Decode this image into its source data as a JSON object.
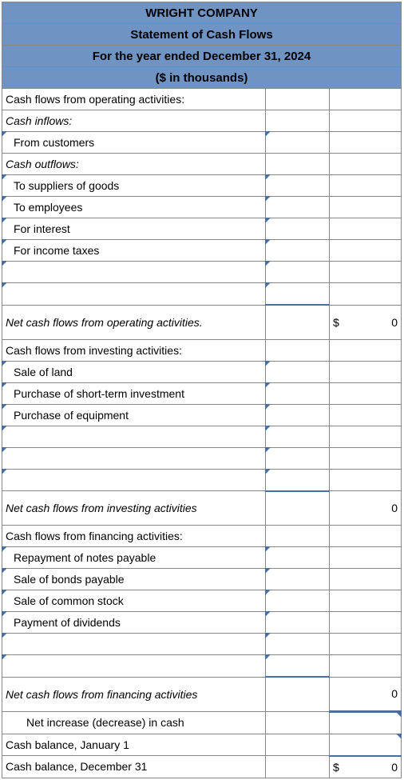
{
  "header": {
    "company": "WRIGHT COMPANY",
    "title": "Statement of Cash Flows",
    "period": "For the year ended December 31, 2024",
    "units": "($ in thousands)"
  },
  "rows": {
    "op_header": "Cash flows from operating activities:",
    "inflows": "Cash inflows:",
    "from_customers": "From customers",
    "outflows": "Cash outflows:",
    "to_suppliers": "To suppliers of goods",
    "to_employees": "To employees",
    "for_interest": "For interest",
    "for_taxes": "For income taxes",
    "net_op": "Net cash flows from operating activities.",
    "inv_header": "Cash flows from investing activities:",
    "sale_land": "Sale of land",
    "purchase_st": "Purchase of short-term investment",
    "purchase_eq": "Purchase of equipment",
    "net_inv": "Net cash flows from investing activities",
    "fin_header": "Cash flows from financing activities:",
    "repay_notes": "Repayment of notes payable",
    "sale_bonds": "Sale of bonds payable",
    "sale_stock": "Sale of common stock",
    "pay_div": "Payment of dividends",
    "net_fin": "Net cash flows from financing activities",
    "net_change": "Net increase (decrease) in cash",
    "beg_bal": "Cash balance, January 1",
    "end_bal": "Cash balance, December 31"
  },
  "values": {
    "net_op_sym": "$",
    "net_op_val": "0",
    "net_inv_val": "0",
    "net_fin_val": "0",
    "end_sym": "$",
    "end_val": "0"
  }
}
